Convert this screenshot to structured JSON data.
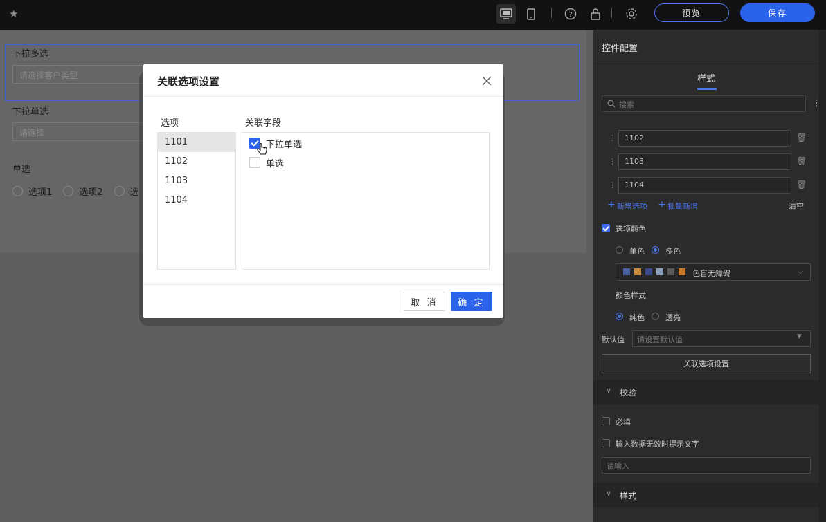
{
  "toolbar": {
    "preview_label": "预览",
    "save_label": "保存"
  },
  "form": {
    "multi_select_label": "下拉多选",
    "multi_select_placeholder": "请选择客户类型",
    "single_select_label": "下拉单选",
    "single_select_placeholder": "请选择",
    "radio_label": "单选",
    "radio_options": [
      "选项1",
      "选项2",
      "选"
    ]
  },
  "panel": {
    "title": "控件配置",
    "tab_style": "样式",
    "search_placeholder": "搜索",
    "options": [
      "1102",
      "1103",
      "1104"
    ],
    "add_option": "新增选项",
    "batch_add": "批量新增",
    "clear": "清空",
    "option_color_label": "选项颜色",
    "mono_color": "单色",
    "multi_color": "多色",
    "color_scheme": "色盲无障碍",
    "color_swatches": [
      "#4a5fa0",
      "#c98a3a",
      "#3a4a8a",
      "#8aa0b8",
      "#5a5a5a",
      "#c87a2a"
    ],
    "color_style_label": "颜色样式",
    "solid": "纯色",
    "transparent": "透亮",
    "default_value_label": "默认值",
    "default_value_placeholder": "请设置默认值",
    "link_options_button": "关联选项设置",
    "validation_section": "校验",
    "required_label": "必填",
    "invalid_hint_label": "输入数据无效时提示文字",
    "invalid_hint_placeholder": "请输入",
    "style_section": "样式"
  },
  "modal": {
    "title": "关联选项设置",
    "options_label": "选项",
    "fields_label": "关联字段",
    "options": [
      "1101",
      "1102",
      "1103",
      "1104"
    ],
    "selected_option": "1101",
    "fields": [
      {
        "label": "下拉单选",
        "checked": true
      },
      {
        "label": "单选",
        "checked": false
      }
    ],
    "cancel_label": "取 消",
    "ok_label": "确 定"
  },
  "colors": {
    "accent": "#2a62ea"
  }
}
